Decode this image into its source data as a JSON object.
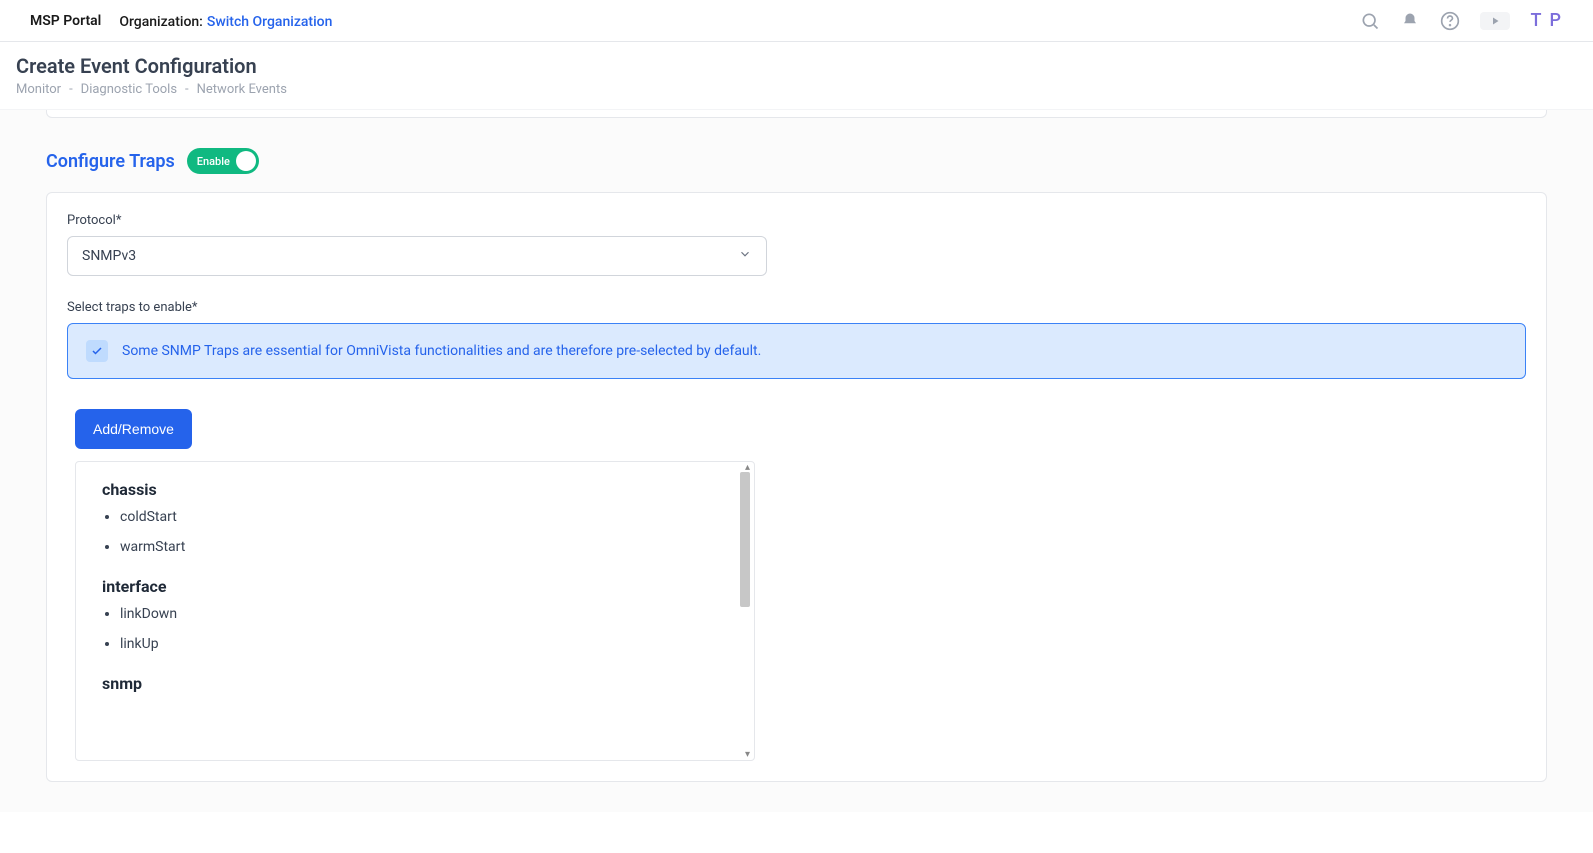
{
  "header": {
    "portal": "MSP Portal",
    "org_label": "Organization:",
    "org_link": "Switch Organization",
    "avatar": "T P"
  },
  "page": {
    "title": "Create Event Configuration",
    "breadcrumb": [
      "Monitor",
      "Diagnostic Tools",
      "Network Events"
    ]
  },
  "section": {
    "title": "Configure Traps",
    "toggle_label": "Enable"
  },
  "form": {
    "protocol_label": "Protocol*",
    "protocol_value": "SNMPv3",
    "select_traps_label": "Select traps to enable*",
    "info_text": "Some SNMP Traps are essential for OmniVista functionalities and are therefore pre-selected by default.",
    "add_remove_label": "Add/Remove"
  },
  "traps": [
    {
      "group": "chassis",
      "items": [
        "coldStart",
        "warmStart"
      ]
    },
    {
      "group": "interface",
      "items": [
        "linkDown",
        "linkUp"
      ]
    },
    {
      "group": "snmp",
      "items": []
    }
  ]
}
